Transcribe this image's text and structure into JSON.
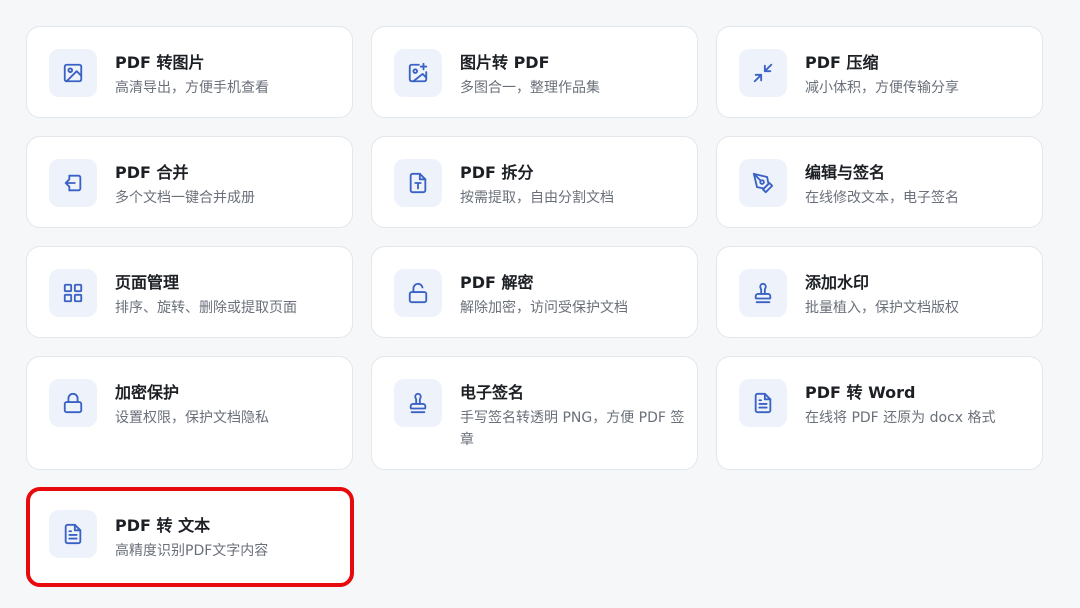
{
  "cards": [
    {
      "title": "PDF 转图片",
      "desc": "高清导出，方便手机查看",
      "icon": "image-icon"
    },
    {
      "title": "图片转 PDF",
      "desc": "多图合一，整理作品集",
      "icon": "image-add-icon"
    },
    {
      "title": "PDF 压缩",
      "desc": "减小体积，方便传输分享",
      "icon": "compress-icon"
    },
    {
      "title": "PDF 合并",
      "desc": "多个文档一键合并成册",
      "icon": "merge-icon"
    },
    {
      "title": "PDF 拆分",
      "desc": "按需提取，自由分割文档",
      "icon": "split-text-icon"
    },
    {
      "title": "编辑与签名",
      "desc": "在线修改文本，电子签名",
      "icon": "pen-icon"
    },
    {
      "title": "页面管理",
      "desc": "排序、旋转、删除或提取页面",
      "icon": "grid-icon"
    },
    {
      "title": "PDF 解密",
      "desc": "解除加密，访问受保护文档",
      "icon": "unlock-icon"
    },
    {
      "title": "添加水印",
      "desc": "批量植入，保护文档版权",
      "icon": "stamp-icon"
    },
    {
      "title": "加密保护",
      "desc": "设置权限，保护文档隐私",
      "icon": "lock-icon"
    },
    {
      "title": "电子签名",
      "desc": "手写签名转透明 PNG，方便 PDF 签章",
      "icon": "stamp-icon"
    },
    {
      "title": "PDF 转 Word",
      "desc": "在线将 PDF 还原为 docx 格式",
      "icon": "document-icon"
    },
    {
      "title": "PDF 转 文本",
      "desc": "高精度识别PDF文字内容",
      "icon": "document-icon"
    }
  ],
  "colors": {
    "accent": "#3a62c4",
    "highlight": "#e8090c"
  }
}
